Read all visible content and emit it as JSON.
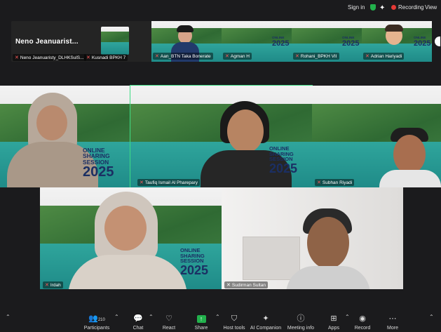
{
  "topbar": {
    "sign_in": "Sign in",
    "recording": "Recording",
    "view": "View"
  },
  "strip": {
    "featured_name": "Neno  Jeanuarist...",
    "featured_label": "Neno Jeanuaristy_DLHKSulS...",
    "kusnadi_label": "Kusnadi BPKH 7",
    "tiles": [
      {
        "label": "Aan_BTN Taka Bonerate"
      },
      {
        "label": "Agman H"
      },
      {
        "label": "Rohani_BPKH VII"
      },
      {
        "label": "Adrian Hariyadi"
      }
    ]
  },
  "banner": {
    "line1": "ONLINE",
    "line2": "SHARING SESSION",
    "year": "2025"
  },
  "gallery": {
    "tiles": [
      {
        "label": ""
      },
      {
        "label": "Taufiq Ismail Al Pharepary"
      },
      {
        "label": "Subhan Riyadi"
      },
      {
        "label": "Irdah"
      },
      {
        "label": "Sudirman Sultan"
      }
    ]
  },
  "toolbar": {
    "participants_label": "Participants",
    "participants_count": "210",
    "chat_label": "Chat",
    "react_label": "React",
    "share_label": "Share",
    "host_tools_label": "Host tools",
    "ai_label": "AI Companion",
    "meeting_info_label": "Meeting info",
    "apps_label": "Apps",
    "record_label": "Record",
    "more_label": "More"
  },
  "colors": {
    "active_speaker": "#3ddc84",
    "recording": "#e53935",
    "brand_navy": "#1b2f63"
  }
}
